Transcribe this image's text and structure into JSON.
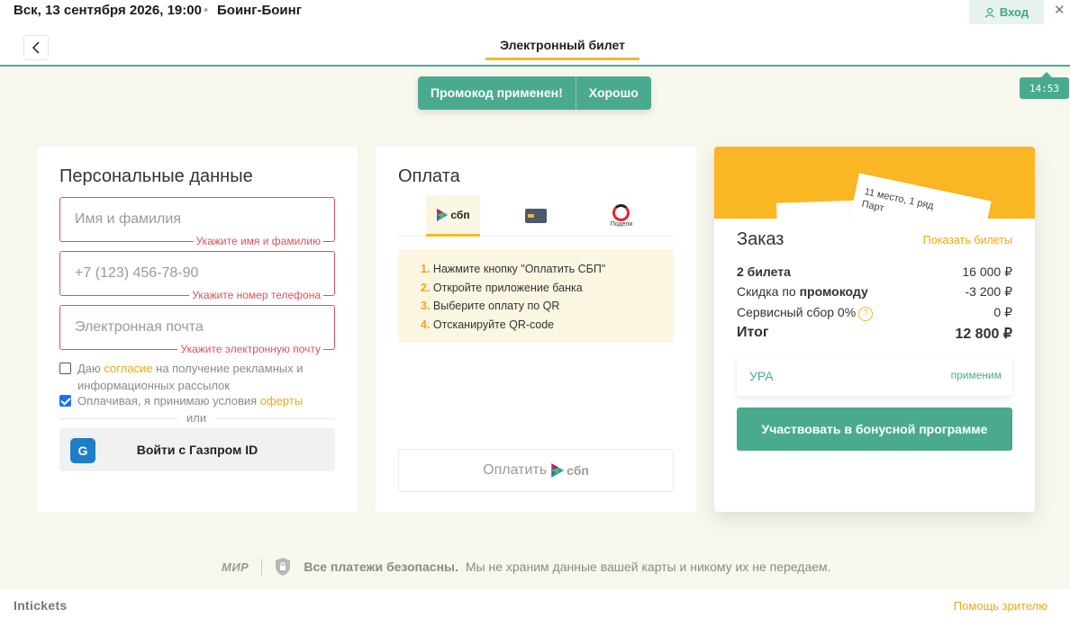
{
  "header": {
    "event_date": "Вск, 13 сентября 2026, 19:00",
    "separator": "•",
    "event_name": "Боинг-Боинг",
    "login_label": "Вход",
    "close": "✕"
  },
  "nav": {
    "title": "Электронный билет"
  },
  "toast": {
    "message": "Промокод применен!",
    "ok_label": "Хорошо"
  },
  "timer": "14:53",
  "personal": {
    "title": "Персональные данные",
    "fields": [
      {
        "placeholder": "Имя и фамилия",
        "error": "Укажите имя и фамилию"
      },
      {
        "placeholder": "+7 (123) 456-78-90",
        "error": "Укажите номер телефона"
      },
      {
        "placeholder": "Электронная почта",
        "error": "Укажите электронную почту"
      }
    ],
    "consent_prefix": "Даю ",
    "consent_link": "согласие",
    "consent_suffix": " на получение рекламных и информационных рассылок",
    "offer_prefix": "Оплачивая, я принимаю условия ",
    "offer_link": "оферты",
    "or": "или",
    "gazprom_label": "Войти с Газпром ID"
  },
  "payment": {
    "title": "Оплата",
    "tabs": [
      "сбп",
      "card",
      "Подели"
    ],
    "steps": [
      {
        "n": "1.",
        "text": "Нажмите кнопку \"Оплатить СБП\""
      },
      {
        "n": "2.",
        "text": "Откройте приложение банка"
      },
      {
        "n": "3.",
        "text": "Выберите оплату по QR"
      },
      {
        "n": "4.",
        "text": "Отсканируйте QR-code"
      }
    ],
    "pay_label": "Оплатить",
    "pay_brand": "сбп"
  },
  "order": {
    "ticket_line1": "11 место, 1 ряд",
    "ticket_line2": "Парт",
    "title": "Заказ",
    "show_tickets": "Показать билеты",
    "rows": [
      {
        "label": "2 билета",
        "value": "16 000 ₽"
      },
      {
        "label_prefix": "Скидка по ",
        "label_bold": "промокоду",
        "value": "-3 200 ₽"
      },
      {
        "label": "Сервисный сбор 0%",
        "value": "0 ₽"
      },
      {
        "label": "Итог",
        "value": "12 800 ₽"
      }
    ],
    "promo_code": "УРА",
    "promo_status": "применим",
    "bonus_label": "Участвовать в бонусной программе"
  },
  "security": {
    "mir": "МИР",
    "bold": "Все платежи безопасны.",
    "text": "Мы не храним данные вашей карты и никому их не передаем."
  },
  "footer": {
    "brand": "Intickets",
    "help": "Помощь зрителю"
  },
  "colors": {
    "accent": "#4aaa90",
    "yellow": "#fbb624",
    "error": "#e0505a",
    "link": "#f0a80e"
  }
}
